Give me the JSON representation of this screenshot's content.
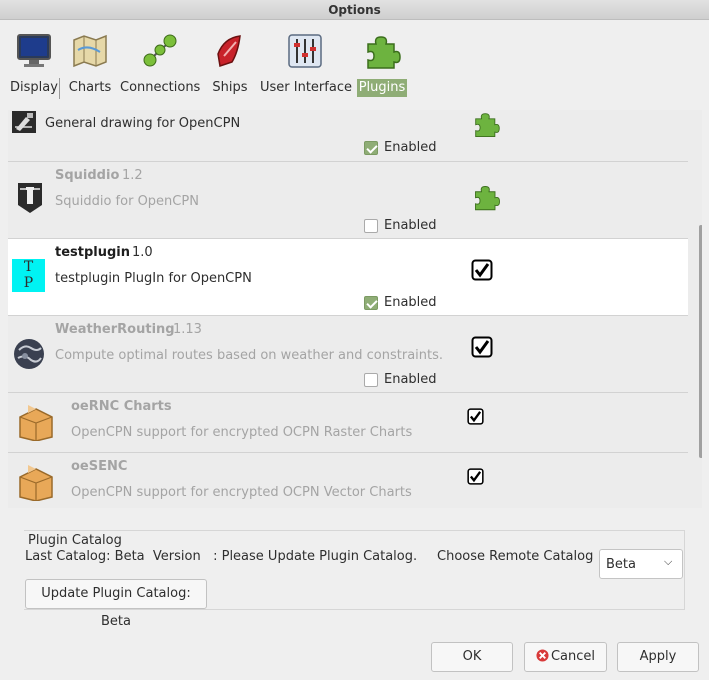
{
  "window": {
    "title": "Options"
  },
  "tabs": [
    {
      "label": "Display",
      "icon": "monitor-icon",
      "active": false
    },
    {
      "label": "Charts",
      "icon": "charts-icon",
      "active": false
    },
    {
      "label": "Connections",
      "icon": "connections-icon",
      "active": false
    },
    {
      "label": "Ships",
      "icon": "ship-icon",
      "active": false
    },
    {
      "label": "User Interface",
      "icon": "sliders-icon",
      "active": false
    },
    {
      "label": "Plugins",
      "icon": "puzzle-icon",
      "active": true
    }
  ],
  "plugins": [
    {
      "name": "",
      "version": "",
      "description": "General drawing for OpenCPN",
      "enabled_label": "Enabled",
      "enabled": true,
      "status_icon": "puzzle-icon",
      "icon": "drawing-tool-icon"
    },
    {
      "name": "Squiddio",
      "version": "1.2",
      "description": "Squiddio for OpenCPN",
      "enabled_label": "Enabled",
      "enabled": false,
      "status_icon": "puzzle-icon",
      "icon": "lighthouse-icon"
    },
    {
      "name": "testplugin",
      "version": "1.0",
      "description": "testplugin PlugIn for OpenCPN",
      "enabled_label": "Enabled",
      "enabled": true,
      "status_icon": "checkbox-icon",
      "icon": "tp-icon",
      "icon_text": "T P"
    },
    {
      "name": "WeatherRouting",
      "version": "1.13",
      "description": "Compute optimal routes based on weather and constraints.",
      "enabled_label": "Enabled",
      "enabled": false,
      "status_icon": "checkbox-icon",
      "icon": "globe-icon"
    },
    {
      "name": "oeRNC Charts",
      "version": "",
      "description": "OpenCPN support for encrypted OCPN Raster Charts",
      "status_icon": "checkbox-icon",
      "icon": "package-icon"
    },
    {
      "name": "oeSENC",
      "version": "",
      "description": "OpenCPN support for encrypted OCPN Vector Charts",
      "status_icon": "checkbox-icon",
      "icon": "package-icon"
    }
  ],
  "catalog": {
    "title": "Plugin Catalog",
    "last_catalog": "Last Catalog: Beta  Version   : Please Update Plugin Catalog.",
    "choose_label": "Choose Remote Catalog",
    "selected": "Beta",
    "update_button": "Update Plugin Catalog: Beta"
  },
  "buttons": {
    "ok": "OK",
    "cancel": "Cancel",
    "apply": "Apply"
  },
  "colors": {
    "accent": "#8fad76",
    "puzzle_green": "#6db33f"
  }
}
